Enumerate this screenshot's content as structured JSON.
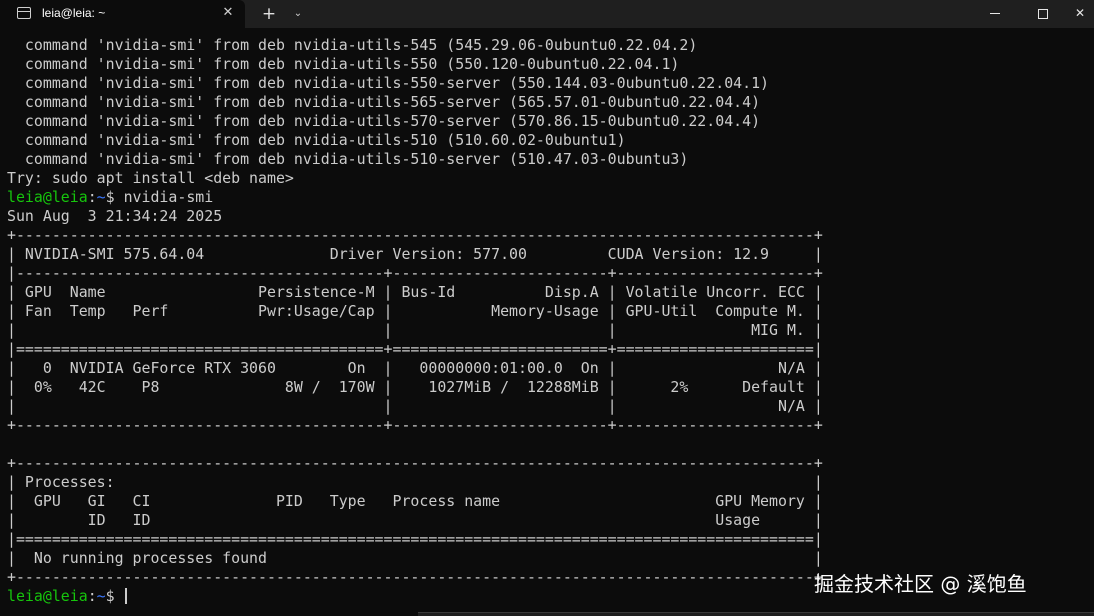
{
  "window": {
    "tab_title": "leia@leia: ~",
    "tab_icon": "terminal-icon",
    "tab_close": "✕",
    "new_tab": "+",
    "dropdown": "⌄",
    "close": "✕"
  },
  "terminal": {
    "lines": [
      "  command 'nvidia-smi' from deb nvidia-utils-545 (545.29.06-0ubuntu0.22.04.2)",
      "  command 'nvidia-smi' from deb nvidia-utils-550 (550.120-0ubuntu0.22.04.1)",
      "  command 'nvidia-smi' from deb nvidia-utils-550-server (550.144.03-0ubuntu0.22.04.1)",
      "  command 'nvidia-smi' from deb nvidia-utils-565-server (565.57.01-0ubuntu0.22.04.4)",
      "  command 'nvidia-smi' from deb nvidia-utils-570-server (570.86.15-0ubuntu0.22.04.4)",
      "  command 'nvidia-smi' from deb nvidia-utils-510 (510.60.02-0ubuntu1)",
      "  command 'nvidia-smi' from deb nvidia-utils-510-server (510.47.03-0ubuntu3)",
      "Try: sudo apt install <deb name>"
    ],
    "prompt1": {
      "user": "leia@leia",
      "sep": ":",
      "path": "~",
      "symbol": "$ ",
      "command": "nvidia-smi"
    },
    "output": [
      "Sun Aug  3 21:34:24 2025",
      "+-----------------------------------------------------------------------------------------+",
      "| NVIDIA-SMI 575.64.04              Driver Version: 577.00         CUDA Version: 12.9     |",
      "|-----------------------------------------+------------------------+----------------------+",
      "| GPU  Name                 Persistence-M | Bus-Id          Disp.A | Volatile Uncorr. ECC |",
      "| Fan  Temp   Perf          Pwr:Usage/Cap |           Memory-Usage | GPU-Util  Compute M. |",
      "|                                         |                        |               MIG M. |",
      "|=========================================+========================+======================|",
      "|   0  NVIDIA GeForce RTX 3060        On  |   00000000:01:00.0  On |                  N/A |",
      "|  0%   42C    P8              8W /  170W |    1027MiB /  12288MiB |      2%      Default |",
      "|                                         |                        |                  N/A |",
      "+-----------------------------------------+------------------------+----------------------+",
      "",
      "+-----------------------------------------------------------------------------------------+",
      "| Processes:                                                                              |",
      "|  GPU   GI   CI              PID   Type   Process name                        GPU Memory |",
      "|        ID   ID                                                               Usage      |",
      "|=========================================================================================|",
      "|  No running processes found                                                             |",
      "+-----------------------------------------------------------------------------------------+"
    ],
    "prompt2": {
      "user": "leia@leia",
      "sep": ":",
      "path": "~",
      "symbol": "$ "
    }
  },
  "watermark": "掘金技术社区 @ 溪饱鱼",
  "colors": {
    "background": "#0c0c0c",
    "foreground": "#cccccc",
    "prompt_user": "#16c60c",
    "prompt_path": "#3b78ff",
    "titlebar": "#1f1f1f"
  }
}
